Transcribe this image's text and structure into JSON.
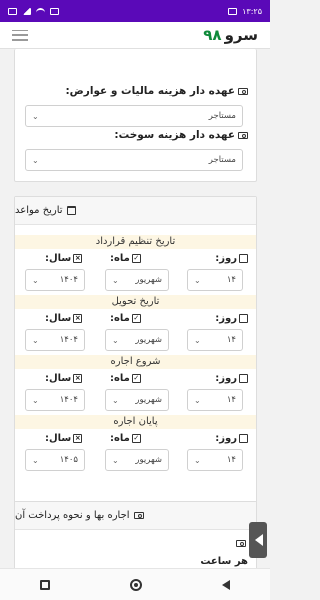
{
  "status_bar": {
    "time": "۱۳:۲۵"
  },
  "app": {
    "logo_word": "سرو",
    "logo_number": "۹۸"
  },
  "form": {
    "tax_label": "عهده دار هزینه مالیات و عوارض:",
    "tax_value": "مستاجر",
    "fuel_label": "عهده دار هزینه سوخت:",
    "fuel_value": "مستاجر"
  },
  "dates_card": {
    "title": "تاریخ مواعد",
    "day_label": "روز:",
    "month_label": "ماه:",
    "year_label": "سال:",
    "sections": [
      {
        "title": "تاریخ تنظیم قرارداد",
        "day": "۱۴",
        "month": "شهریور",
        "year": "۱۴۰۴"
      },
      {
        "title": "تاریخ تحویل",
        "day": "۱۴",
        "month": "شهریور",
        "year": "۱۴۰۴"
      },
      {
        "title": "شروع اجاره",
        "day": "۱۴",
        "month": "شهریور",
        "year": "۱۴۰۴"
      },
      {
        "title": "پایان اجاره",
        "day": "۱۴",
        "month": "شهریور",
        "year": "۱۴۰۵"
      }
    ]
  },
  "rent_card": {
    "title": "اجاره بها و نحوه پرداخت آن",
    "partial_label": "هر ساعت"
  }
}
